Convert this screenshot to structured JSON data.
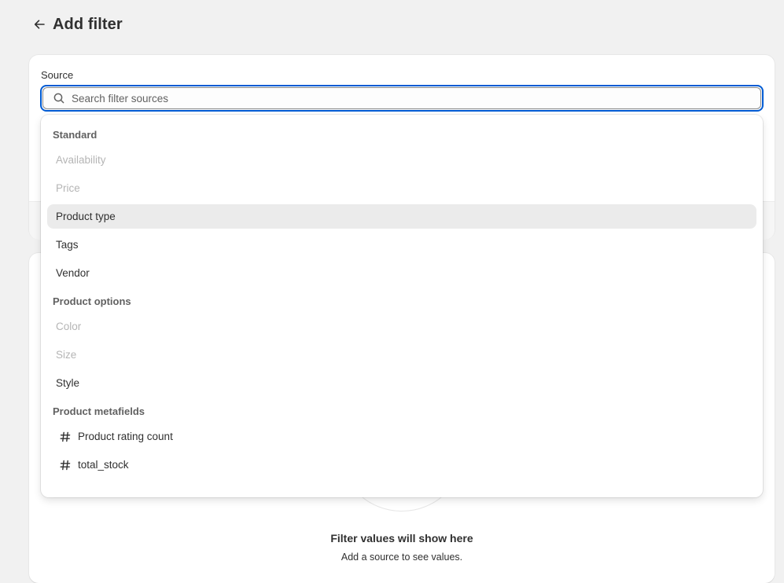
{
  "header": {
    "title": "Add filter"
  },
  "source": {
    "label": "Source",
    "search_placeholder": "Search filter sources",
    "search_value": ""
  },
  "dropdown": {
    "sections": [
      {
        "title": "Standard",
        "items": [
          {
            "label": "Availability",
            "state": "disabled"
          },
          {
            "label": "Price",
            "state": "disabled"
          },
          {
            "label": "Product type",
            "state": "active"
          },
          {
            "label": "Tags",
            "state": "enabled"
          },
          {
            "label": "Vendor",
            "state": "enabled"
          }
        ]
      },
      {
        "title": "Product options",
        "items": [
          {
            "label": "Color",
            "state": "disabled"
          },
          {
            "label": "Size",
            "state": "disabled"
          },
          {
            "label": "Style",
            "state": "enabled"
          }
        ]
      },
      {
        "title": "Product metafields",
        "items": [
          {
            "label": "Product rating count",
            "state": "enabled",
            "icon": "hash-icon"
          },
          {
            "label": "total_stock",
            "state": "enabled",
            "icon": "hash-icon"
          }
        ]
      }
    ]
  },
  "values_card": {
    "empty_title": "Filter values will show here",
    "empty_subtitle": "Add a source to see values."
  },
  "colors": {
    "background": "#f1f1f1",
    "focus_ring": "#005bd3",
    "highlight": "#ebebeb",
    "disabled_text": "#b5b5b5"
  }
}
